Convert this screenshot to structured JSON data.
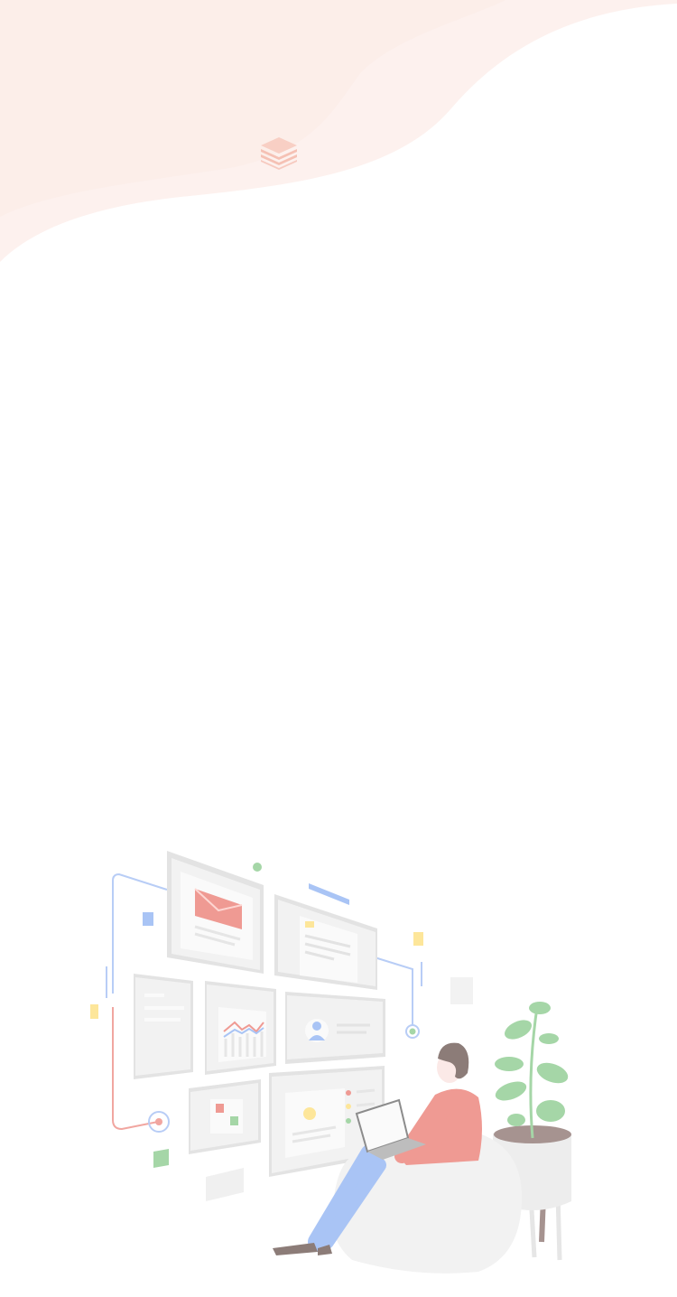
{
  "header": {
    "logo_icon": "stacked-layers-icon"
  },
  "illustration": {
    "icon": "person-working-with-dashboard-illustration"
  },
  "colors": {
    "header_bg": "#fdf1ee",
    "logo": "#f5c1b4",
    "panel": "#f2f2f2",
    "panel_edge": "#e3e3e3",
    "accent_red": "#ef9a93",
    "accent_blue": "#a9c4f5",
    "accent_green": "#a5d6a7",
    "accent_yellow": "#fde69a"
  }
}
